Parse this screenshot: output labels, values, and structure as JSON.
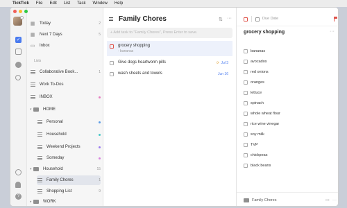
{
  "menubar": {
    "app_name": "TickTick",
    "items": [
      "File",
      "Edit",
      "List",
      "Task",
      "Window",
      "Help"
    ]
  },
  "colors": {
    "close": "#f25f57",
    "minimize": "#fbbc2e",
    "zoom": "#30c843",
    "accent": "#4a7bef",
    "priority_red": "#e0524a",
    "dot_inbox": "#e57ec0",
    "dot_personal": "#5b9be6",
    "dot_household": "#47c7c7",
    "dot_weekend": "#9b7cf0",
    "dot_someday": "#d882de",
    "dot_family": "#f0c94a"
  },
  "sidebar": {
    "smart_lists": [
      {
        "label": "Today",
        "count": "2",
        "icon": "today-icon"
      },
      {
        "label": "Next 7 Days",
        "count": "5",
        "icon": "next-7-days-icon"
      },
      {
        "label": "Inbox",
        "count": "",
        "icon": "inbox-icon"
      }
    ],
    "lists_heading": "Lists",
    "lists": [
      {
        "label": "Collaborative Book...",
        "count": "1"
      },
      {
        "label": "Work To-Dos",
        "count": ""
      },
      {
        "label": "INBOX",
        "count": ""
      }
    ],
    "home_folder": "HOME",
    "home_items": [
      {
        "label": "Personal"
      },
      {
        "label": "Household"
      },
      {
        "label": "Weekend Projects"
      },
      {
        "label": "Someday"
      }
    ],
    "household_folder": "Household",
    "household_folder_count": "15",
    "household_items": [
      {
        "label": "Family Chores",
        "count": "1"
      },
      {
        "label": "Shopping List",
        "count": "9"
      }
    ],
    "work_folder": "WORK"
  },
  "list": {
    "title": "Family Chores",
    "add_placeholder": "+ Add task to \"Family Chores\", Press Enter to save.",
    "tasks": [
      {
        "name": "grocery shopping",
        "sub": "- bananas",
        "due": "",
        "repeat": ""
      },
      {
        "name": "Give dogs heartworm pills",
        "sub": "",
        "due": "Jul 3",
        "repeat": "⟳"
      },
      {
        "name": "wash sheets and towels",
        "sub": "",
        "due": "Jun 16",
        "repeat": ""
      }
    ]
  },
  "detail": {
    "due_date_label": "Due Date",
    "title": "grocery shopping",
    "subtasks": [
      "bananas",
      "avocados",
      "red onions",
      "oranges",
      "lettuce",
      "spinach",
      "whole wheat flour",
      "rice wine vinegar",
      "soy milk",
      "TVP",
      "chickpeas",
      "black beans"
    ],
    "footer_list": "Family Chores"
  }
}
